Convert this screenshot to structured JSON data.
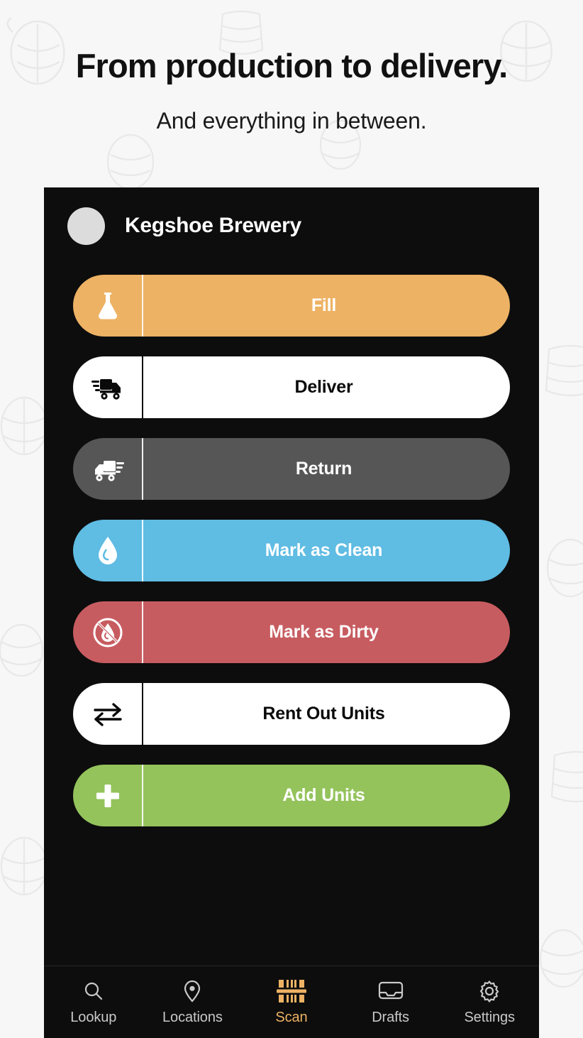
{
  "hero": {
    "title": "From production to delivery.",
    "subtitle": "And everything in between."
  },
  "colors": {
    "accent": "#edb264",
    "page_background": "#f7f7f7",
    "app_background": "#0d0d0d",
    "fill": "#edb264",
    "deliver": "#ffffff",
    "return": "#565656",
    "clean": "#5fbce3",
    "dirty": "#c75c60",
    "rent": "#ffffff",
    "add": "#94c35c"
  },
  "app": {
    "header": {
      "avatar": "avatar-placeholder",
      "org_name": "Kegshoe Brewery"
    },
    "actions": [
      {
        "label": "Fill",
        "icon": "flask-icon",
        "variant": "v-orange"
      },
      {
        "label": "Deliver",
        "icon": "truck-right-icon",
        "variant": "v-white"
      },
      {
        "label": "Return",
        "icon": "truck-left-icon",
        "variant": "v-gray"
      },
      {
        "label": "Mark as Clean",
        "icon": "water-drop-icon",
        "variant": "v-blue"
      },
      {
        "label": "Mark as Dirty",
        "icon": "drop-slash-icon",
        "variant": "v-red"
      },
      {
        "label": "Rent Out Units",
        "icon": "exchange-icon",
        "variant": "v-white"
      },
      {
        "label": "Add Units",
        "icon": "plus-icon",
        "variant": "v-green"
      }
    ],
    "tabs": [
      {
        "label": "Lookup",
        "icon": "search-icon",
        "active": false
      },
      {
        "label": "Locations",
        "icon": "map-pin-icon",
        "active": false
      },
      {
        "label": "Scan",
        "icon": "barcode-icon",
        "active": true
      },
      {
        "label": "Drafts",
        "icon": "inbox-icon",
        "active": false
      },
      {
        "label": "Settings",
        "icon": "gear-icon",
        "active": false
      }
    ]
  }
}
